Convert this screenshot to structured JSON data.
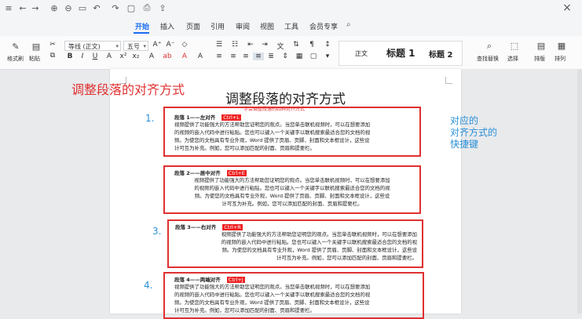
{
  "window": {
    "close_label": "×"
  },
  "quick_access": [
    {
      "name": "menu-icon",
      "glyph": "≡"
    },
    {
      "name": "undo-icon",
      "glyph": "←"
    },
    {
      "name": "redo-icon",
      "glyph": "→"
    },
    {
      "name": "save-icon",
      "glyph": "▢"
    },
    {
      "name": "print-icon",
      "glyph": "⎙"
    },
    {
      "name": "zoom-icon",
      "glyph": "⊕"
    },
    {
      "name": "preview-icon",
      "glyph": "⊖"
    },
    {
      "name": "layout-icon",
      "glyph": "▭"
    },
    {
      "name": "undo-arrow-icon",
      "glyph": "↶"
    },
    {
      "name": "redo-arrow-icon",
      "glyph": "↷"
    },
    {
      "name": "share-icon",
      "glyph": "⇪"
    }
  ],
  "tabs": [
    "开始",
    "插入",
    "页面",
    "引用",
    "审阅",
    "视图",
    "工具",
    "会员专享"
  ],
  "ribbon": {
    "format_painter": "格式刷",
    "paste": "粘贴",
    "font_name": "等线 (正文)",
    "font_size": "五号",
    "styles": [
      "正文",
      "标题 1",
      "标题 2"
    ],
    "find_replace": "查找替换",
    "select": "选择",
    "sort": "排版",
    "arrange": "排列"
  },
  "document": {
    "title": "调整段落的对齐方式",
    "subtitle": "学会调整段落的四种对齐方式",
    "paragraphs": [
      {
        "number": "1.",
        "heading": "段落 1——左对齐",
        "shortcut": "Ctrl+L",
        "lines": [
          "视频提供了功能强大的方法帮助您证明您的观点。当您单击联机视频时，可以在想要添加",
          "的视频的嵌入代码中进行粘贴。您也可以键入一个关键字以联机搜索最适合您的文档的视",
          "频。为使您的文档具有专业外观，Word 提供了页眉、页脚、封面和文本框设计，这些设",
          "计可互为补充。例如，您可以添加匹配的封面、页眉和提要栏。"
        ]
      },
      {
        "number": "",
        "heading": "段落 2——居中对齐",
        "shortcut": "Ctrl+E",
        "lines": [
          "视频提供了功能强大的方法帮助您证明您的观点。当您单击联机视频时，可以在想要添加",
          "的视频的嵌入代码中进行粘贴。您也可以键入一个关键字以联机搜索最适合您的文档的视",
          "频。为使您的文档具有专业外观，Word 提供了页眉、页脚、封面和文本框设计，这些设",
          "计可互为补充。例如，您可以添加匹配的封面、页眉和提要栏。"
        ]
      },
      {
        "number": "3.",
        "heading": "段落 3——右对齐",
        "shortcut": "Ctrl+R",
        "lines": [
          "视频提供了功能强大的方法帮助您证明您的观点。当您单击联机视频时，可以在想要添加",
          "的视频的嵌入代码中进行粘贴。您也可以键入一个关键字以联机搜索最适合您的文档的视",
          "频。为使您的文档具有专业外观，Word 提供了页眉、页脚、封面和文本框设计，这些设",
          "计可互为补充。例如，您可以添加匹配的封面、页眉和提要栏。"
        ]
      },
      {
        "number": "4.",
        "heading": "段落 4——两端对齐",
        "shortcut": "Ctrl+J",
        "lines": [
          "视频提供了功能强大的方法帮助您证明您的观点。当您单击联机视频时，可以在想要添加",
          "的视频的嵌入代码中进行粘贴。您也可以键入一个关键字以联机搜索最适合您的文档的视",
          "频。为使您的文档具有专业外观，Word 提供了页眉、页脚、封面和文本框设计，这些设",
          "计可互为补充。例如，您可以添加匹配的封面、页眉和提要栏。"
        ]
      }
    ]
  },
  "annotations": {
    "left": "调整段落的对齐方式",
    "right": [
      "对应的",
      "对齐方式的",
      "快捷键"
    ]
  },
  "colors": {
    "accent": "#1a6df3",
    "highlight_red": "#e03030",
    "annotation_blue": "#2a8fd8"
  }
}
